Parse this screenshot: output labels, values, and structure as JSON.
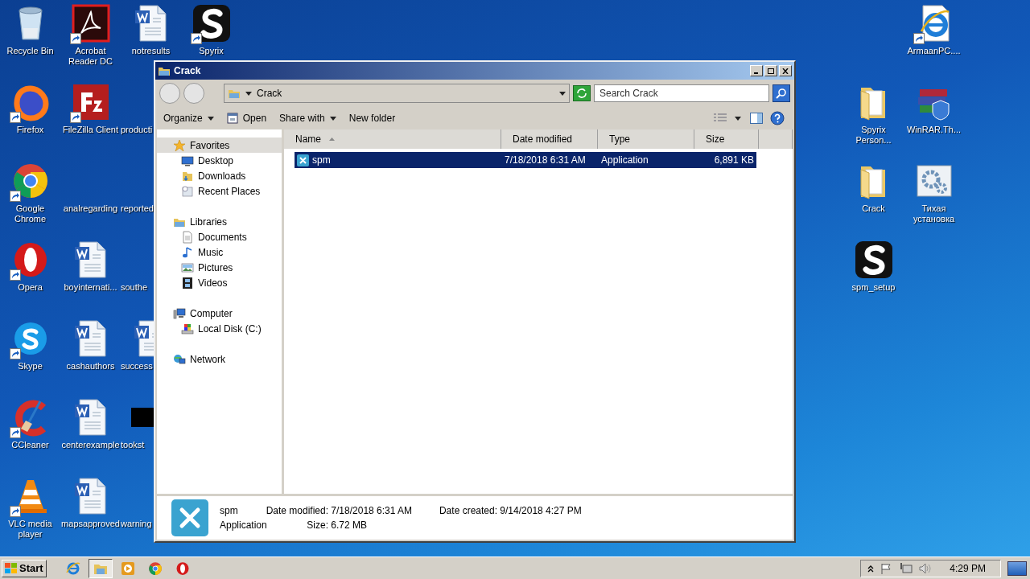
{
  "desktop": {
    "left_columns": [
      [
        {
          "label": "Recycle Bin",
          "kind": "recycle",
          "shortcut": false
        },
        {
          "label": "Firefox",
          "kind": "firefox",
          "shortcut": true
        },
        {
          "label": "Google Chrome",
          "kind": "chrome",
          "shortcut": true
        },
        {
          "label": "Opera",
          "kind": "opera",
          "shortcut": true
        },
        {
          "label": "Skype",
          "kind": "skype",
          "shortcut": true
        },
        {
          "label": "CCleaner",
          "kind": "ccleaner",
          "shortcut": true
        },
        {
          "label": "VLC media player",
          "kind": "vlc",
          "shortcut": true
        }
      ],
      [
        {
          "label": "Acrobat Reader DC",
          "kind": "acrobat",
          "shortcut": true
        },
        {
          "label": "FileZilla Client",
          "kind": "filezilla",
          "shortcut": true
        },
        {
          "label": "analregarding",
          "kind": "blank",
          "shortcut": false
        },
        {
          "label": "boyinternati...",
          "kind": "word",
          "shortcut": false
        },
        {
          "label": "cashauthors",
          "kind": "word",
          "shortcut": false
        },
        {
          "label": "centerexample",
          "kind": "word",
          "shortcut": false
        },
        {
          "label": "mapsapproved",
          "kind": "word",
          "shortcut": false
        }
      ],
      [
        {
          "label": "notresults",
          "kind": "word",
          "shortcut": false
        },
        {
          "label": "producti",
          "kind": "blank",
          "shortcut": false
        },
        {
          "label": "reported",
          "kind": "blank",
          "shortcut": false
        },
        {
          "label": "southe",
          "kind": "blank",
          "shortcut": false
        },
        {
          "label": "success",
          "kind": "word",
          "shortcut": false
        },
        {
          "label": "tookst",
          "kind": "black",
          "shortcut": false
        },
        {
          "label": "warning",
          "kind": "blank",
          "shortcut": false
        }
      ],
      [
        {
          "label": "Spyrix",
          "kind": "spyrix",
          "shortcut": true
        }
      ]
    ],
    "right_columns": [
      [
        {
          "label": "Spyrix Person...",
          "kind": "folder",
          "shortcut": false
        },
        {
          "label": "Crack",
          "kind": "folder",
          "shortcut": false
        },
        {
          "label": "spm_setup",
          "kind": "spyrix",
          "shortcut": false
        }
      ],
      [
        {
          "label": "ArmaanPC....",
          "kind": "ie",
          "shortcut": true
        },
        {
          "label": "WinRAR.Th...",
          "kind": "winrar",
          "shortcut": false
        },
        {
          "label": "Тихая установка",
          "kind": "gears",
          "shortcut": false
        }
      ]
    ]
  },
  "window": {
    "title": "Crack",
    "address": "Crack",
    "search": {
      "placeholder": "Search Crack"
    },
    "toolbar": [
      {
        "label": "Organize",
        "kind": "menu"
      },
      {
        "label": "Open",
        "kind": "open"
      },
      {
        "label": "Share with",
        "kind": "menu"
      },
      {
        "label": "New folder",
        "kind": "plain"
      }
    ],
    "nav": [
      {
        "label": "Favorites",
        "kind": "star",
        "selected": true,
        "children": [
          {
            "label": "Desktop",
            "kind": "desktop",
            "selected": false
          },
          {
            "label": "Downloads",
            "kind": "folder",
            "selected": false
          },
          {
            "label": "Recent Places",
            "kind": "recent",
            "selected": false
          }
        ]
      },
      {
        "label": "Libraries",
        "kind": "library",
        "selected": false,
        "children": [
          {
            "label": "Documents",
            "kind": "documents",
            "selected": false
          },
          {
            "label": "Music",
            "kind": "music",
            "selected": false
          },
          {
            "label": "Pictures",
            "kind": "pictures",
            "selected": false
          },
          {
            "label": "Videos",
            "kind": "videos",
            "selected": false
          }
        ]
      },
      {
        "label": "Computer",
        "kind": "computer",
        "selected": false,
        "children": [
          {
            "label": "Local Disk (C:)",
            "kind": "disk",
            "selected": false
          }
        ]
      },
      {
        "label": "Network",
        "kind": "network",
        "selected": false
      }
    ],
    "columns": [
      {
        "label": "Name",
        "sorted": true
      },
      {
        "label": "Date modified",
        "sorted": false
      },
      {
        "label": "Type",
        "sorted": false
      },
      {
        "label": "Size",
        "sorted": false
      }
    ],
    "files": [
      {
        "name": "spm",
        "date_modified": "7/18/2018 6:31 AM",
        "type": "Application",
        "size": "6,891 KB",
        "selected": true
      }
    ],
    "details": {
      "name": "spm",
      "type": "Application",
      "rows": [
        [
          {
            "label": "Date modified:",
            "value": "7/18/2018 6:31 AM"
          },
          {
            "label": "Date created:",
            "value": "9/14/2018 4:27 PM"
          }
        ],
        [
          {
            "label": "Size:",
            "value": "6.72 MB"
          }
        ]
      ]
    }
  },
  "taskbar": {
    "start": "Start",
    "apps": [
      {
        "kind": "ie",
        "selected": false
      },
      {
        "kind": "explorer",
        "selected": true
      },
      {
        "kind": "media",
        "selected": false
      },
      {
        "kind": "chrome",
        "selected": false
      },
      {
        "kind": "opera",
        "selected": false
      }
    ],
    "clock": "4:29 PM"
  }
}
